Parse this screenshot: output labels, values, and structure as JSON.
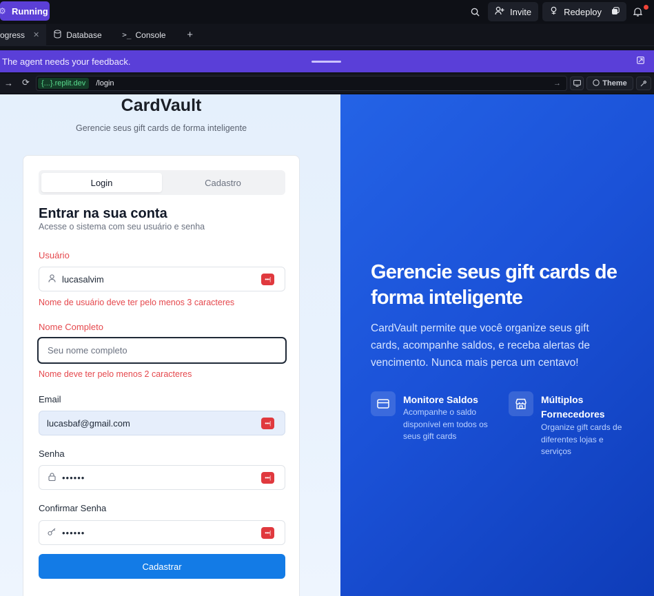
{
  "topbar": {
    "run_label": "Running",
    "invite_label": "Invite",
    "redeploy_label": "Redeploy"
  },
  "tabs": [
    {
      "label": "ogress",
      "closable": true,
      "active": true
    },
    {
      "label": "Database",
      "icon": "database-icon"
    },
    {
      "label": "Console",
      "icon": "terminal-icon"
    }
  ],
  "banner": {
    "message": "The agent needs your feedback."
  },
  "urlbar": {
    "domain": "{...}.replit.dev",
    "path": "/login",
    "theme_label": "Theme"
  },
  "app": {
    "title": "CardVault",
    "subtitle": "Gerencie seus gift cards de forma inteligente",
    "tab_login": "Login",
    "tab_register": "Cadastro",
    "form_title": "Entrar na sua conta",
    "form_subtitle": "Acesse o sistema com seu usuário e senha",
    "fields": {
      "username": {
        "label": "Usuário",
        "value": "lucasalvim",
        "error": "Nome de usuário deve ter pelo menos 3 caracteres"
      },
      "fullname": {
        "label": "Nome Completo",
        "placeholder": "Seu nome completo",
        "error": "Nome deve ter pelo menos 2 caracteres"
      },
      "email": {
        "label": "Email",
        "value": "lucasbaf@gmail.com"
      },
      "password": {
        "label": "Senha",
        "value": "••••••"
      },
      "confirm": {
        "label": "Confirmar Senha",
        "value": "••••••"
      }
    },
    "submit_label": "Cadastrar",
    "password_manager_glyph": "•••|"
  },
  "hero": {
    "title": "Gerencie seus gift cards de forma inteligente",
    "text": "CardVault permite que você organize seus gift cards, acompanhe saldos, e receba alertas de vencimento. Nunca mais perca um centavo!",
    "features": [
      {
        "icon": "credit-card-icon",
        "title": "Monitore Saldos",
        "description": "Acompanhe o saldo disponível em todos os seus gift cards"
      },
      {
        "icon": "store-icon",
        "title": "Múltiplos Fornecedores",
        "description": "Organize gift cards de diferentes lojas e serviços"
      }
    ]
  },
  "colors": {
    "accent": "#5a3fd8",
    "primary_button": "#137be6",
    "error": "#e5484d",
    "hero_bg": "#1b52d8"
  }
}
